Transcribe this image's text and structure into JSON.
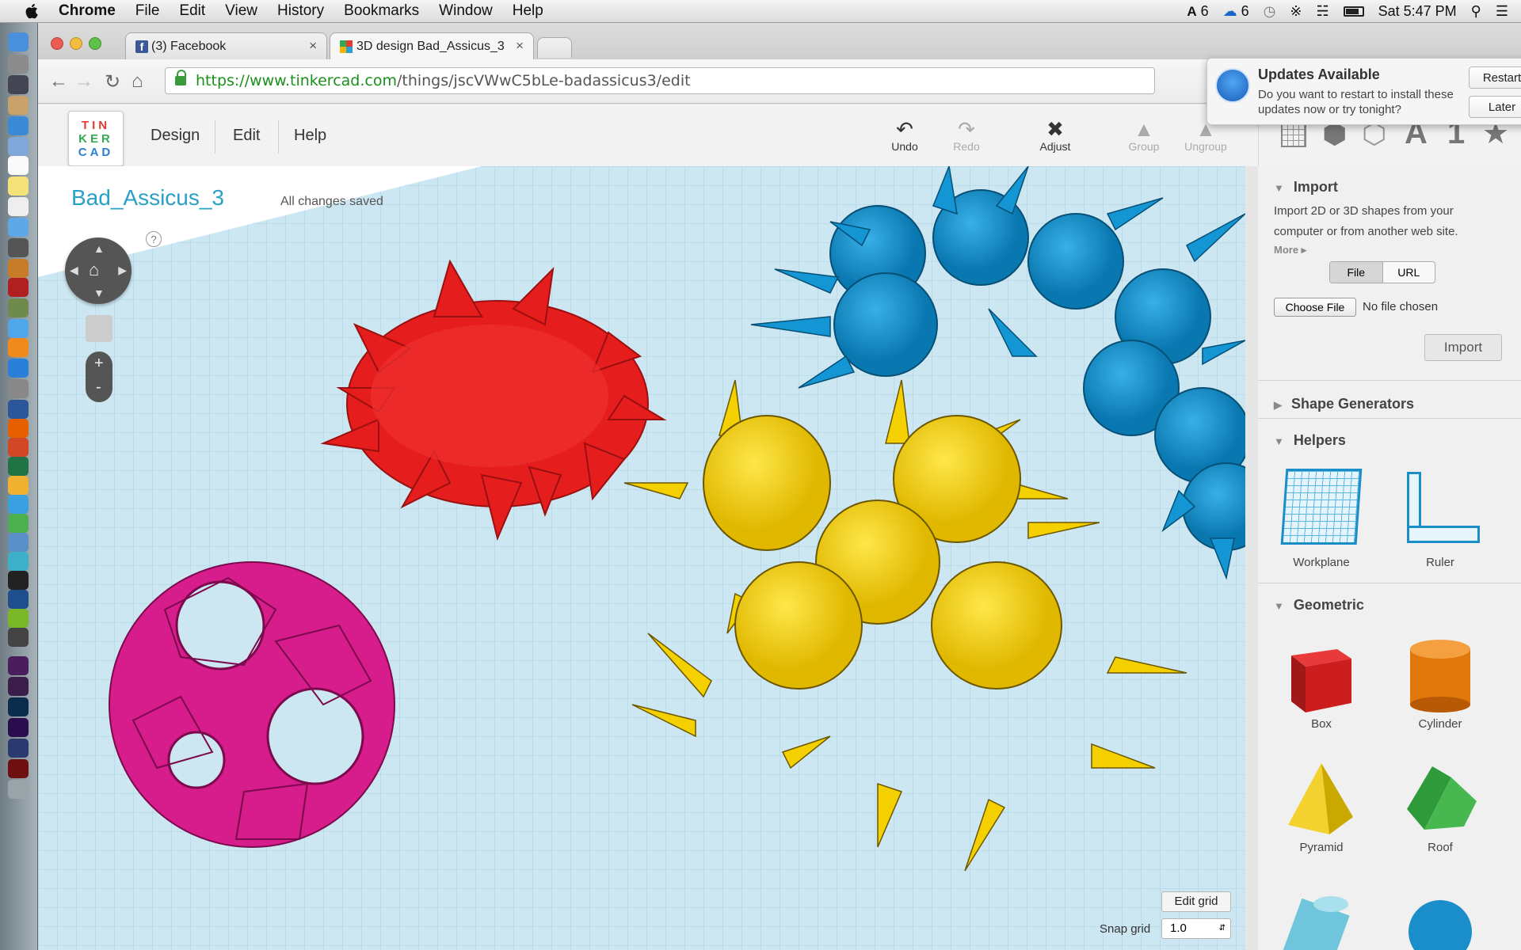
{
  "menubar": {
    "app": "Chrome",
    "items": [
      "File",
      "Edit",
      "View",
      "History",
      "Bookmarks",
      "Window",
      "Help"
    ],
    "status": {
      "adobe_count": "6",
      "cc_count": "6",
      "clock": "Sat 5:47 PM"
    }
  },
  "browser": {
    "tabs": [
      {
        "label": "(3) Facebook"
      },
      {
        "label": "3D design Bad_Assicus_3"
      }
    ],
    "url_host": "https://www.tinkercad.com",
    "url_path": "/things/jscVWwC5bLe-badassicus3/edit"
  },
  "notification": {
    "title": "Updates Available",
    "message": "Do you want to restart to install these updates now or try tonight?",
    "restart_label": "Restart",
    "later_label": "Later"
  },
  "tinkercad": {
    "logo_lines": [
      "TIN",
      "KER",
      "CAD"
    ],
    "nav": [
      "Design",
      "Edit",
      "Help"
    ],
    "tools": {
      "undo": "Undo",
      "redo": "Redo",
      "adjust": "Adjust",
      "group": "Group",
      "ungroup": "Ungroup"
    },
    "panel_tool_letters": {
      "text": "A",
      "number": "1"
    },
    "design_name": "Bad_Assicus_3",
    "save_status": "All changes saved",
    "help_mark": "?",
    "zoom_in": "+",
    "zoom_out": "-",
    "edit_grid_label": "Edit grid",
    "snap_grid_label": "Snap grid",
    "snap_grid_value": "1.0"
  },
  "panel": {
    "import": {
      "title": "Import",
      "description": "Import 2D or 3D shapes from your computer or from another web site.",
      "more": "More",
      "file_tab": "File",
      "url_tab": "URL",
      "choose_file": "Choose File",
      "no_file": "No file chosen",
      "import_button": "Import"
    },
    "shape_generators": "Shape Generators",
    "helpers": {
      "title": "Helpers",
      "items": [
        "Workplane",
        "Ruler"
      ]
    },
    "geometric": {
      "title": "Geometric",
      "items": [
        "Box",
        "Cylinder",
        "Pyramid",
        "Roof"
      ]
    }
  }
}
